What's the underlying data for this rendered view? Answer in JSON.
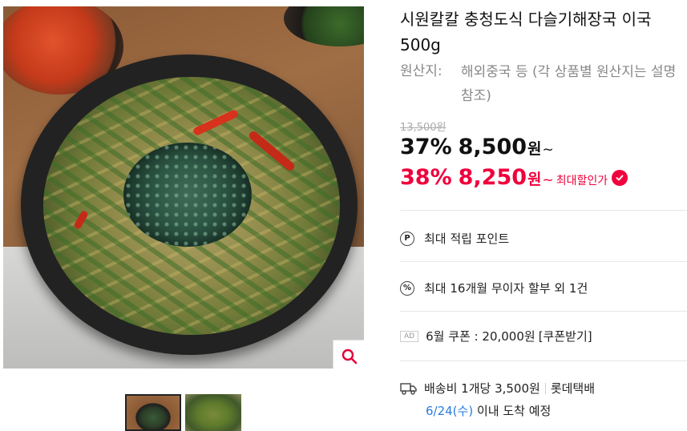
{
  "product": {
    "title": "시원칼칼 충청도식 다슬기해장국 이국 500g",
    "origin_label": "원산지:",
    "origin_value": "해외중국 등 (각 상품별 원산지는 설명 참조)"
  },
  "price": {
    "original": "13,500원",
    "discount_rate": "37%",
    "sale_amount": "8,500",
    "max_rate": "38%",
    "max_amount": "8,250",
    "won_unit": "원",
    "tilde": "~",
    "max_label": "최대할인가"
  },
  "benefits": {
    "points_icon_text": "P",
    "points_label": "최대 적립 포인트",
    "installment_icon_text": "%",
    "installment_label": "최대 16개월 무이자 할부 외 1건",
    "ad_badge": "AD",
    "coupon_label": "6월 쿠폰 : 20,000원",
    "coupon_link": "[쿠폰받기]"
  },
  "shipping": {
    "fee": "배송비 1개당 3,500원",
    "carrier": "롯데택배",
    "arrival_date": "6/24(수)",
    "arrival_suffix": "이내 도착 예정"
  },
  "colors": {
    "accent": "#f0003c",
    "date_blue": "#2a7de1",
    "muted": "#888888"
  },
  "icons": [
    "magnifier-icon",
    "heart-check-icon",
    "points-icon",
    "percent-icon",
    "truck-icon"
  ]
}
